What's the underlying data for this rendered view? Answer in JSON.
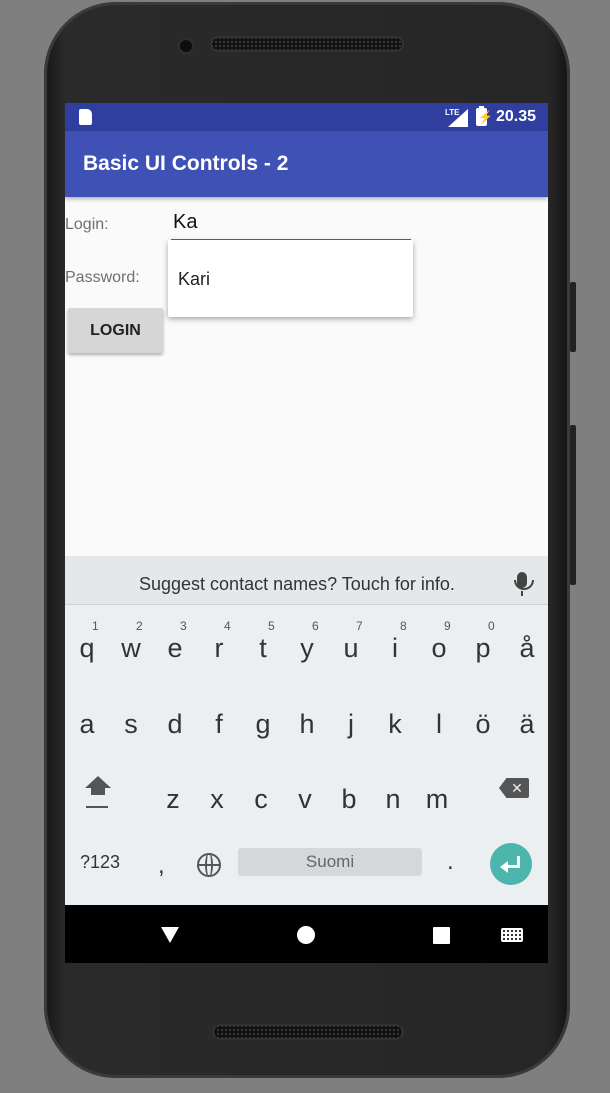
{
  "status_bar": {
    "network_label": "LTE",
    "time": "20.35"
  },
  "app_bar": {
    "title": "Basic UI Controls - 2"
  },
  "form": {
    "login_label": "Login:",
    "login_value": "Ka",
    "password_label": "Password:",
    "login_button": "LOGIN"
  },
  "autocomplete": {
    "items": [
      "Kari"
    ]
  },
  "keyboard": {
    "suggestion": "Suggest contact names? Touch for info.",
    "row1": [
      {
        "ch": "q",
        "num": "1"
      },
      {
        "ch": "w",
        "num": "2"
      },
      {
        "ch": "e",
        "num": "3"
      },
      {
        "ch": "r",
        "num": "4"
      },
      {
        "ch": "t",
        "num": "5"
      },
      {
        "ch": "y",
        "num": "6"
      },
      {
        "ch": "u",
        "num": "7"
      },
      {
        "ch": "i",
        "num": "8"
      },
      {
        "ch": "o",
        "num": "9"
      },
      {
        "ch": "p",
        "num": "0"
      },
      {
        "ch": "å",
        "num": ""
      }
    ],
    "row2": [
      "a",
      "s",
      "d",
      "f",
      "g",
      "h",
      "j",
      "k",
      "l",
      "ö",
      "ä"
    ],
    "row3": [
      "z",
      "x",
      "c",
      "v",
      "b",
      "n",
      "m"
    ],
    "symbols_key": "?123",
    "comma_key": ",",
    "space_label": "Suomi",
    "period_key": "."
  }
}
